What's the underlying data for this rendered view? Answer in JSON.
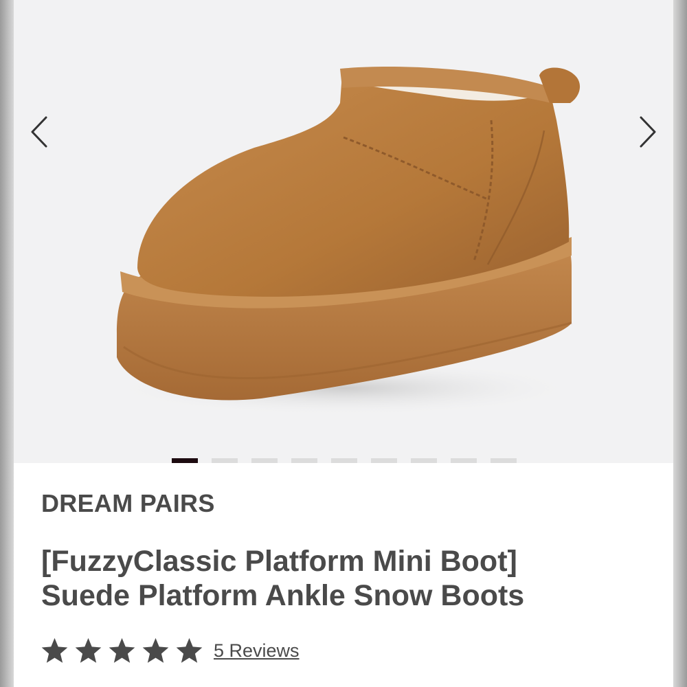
{
  "product": {
    "brand": "DREAM PAIRS",
    "title_line1": "[FuzzyClassic Platform Mini Boot]",
    "title_line2": "Suede Platform Ankle Snow Boots",
    "rating_stars": 5,
    "reviews_label": "5 Reviews"
  },
  "gallery": {
    "image_subject": "chestnut suede platform mini boot",
    "total_images": 9,
    "active_index": 0,
    "prev_icon": "chevron-left-icon",
    "next_icon": "chevron-right-icon"
  },
  "colors": {
    "text": "#4a4a4a",
    "active_dot": "#1d0b10",
    "inactive_dot": "#dcdcdc",
    "star": "#4a4a4a",
    "boot": "#b97c3f"
  }
}
